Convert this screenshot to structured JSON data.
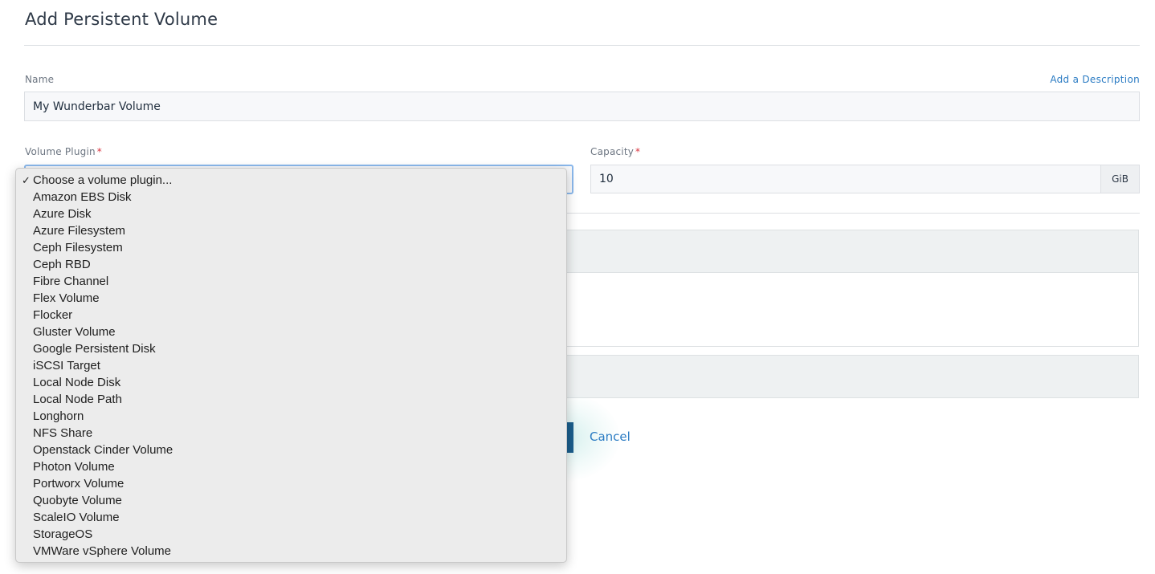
{
  "page": {
    "title": "Add Persistent Volume"
  },
  "name_field": {
    "label": "Name",
    "value": "My Wunderbar Volume",
    "add_description_link": "Add a Description"
  },
  "volume_plugin": {
    "label": "Volume Plugin",
    "required_marker": "*",
    "selected": "Choose a volume plugin...",
    "selected_check": "✓",
    "options": [
      "Choose a volume plugin...",
      "Amazon EBS Disk",
      "Azure Disk",
      "Azure Filesystem",
      "Ceph Filesystem",
      "Ceph RBD",
      "Fibre Channel",
      "Flex Volume",
      "Flocker",
      "Gluster Volume",
      "Google Persistent Disk",
      "iSCSI Target",
      "Local Node Disk",
      "Local Node Path",
      "Longhorn",
      "NFS Share",
      "Openstack Cinder Volume",
      "Photon Volume",
      "Portworx Volume",
      "Quobyte Volume",
      "ScaleIO Volume",
      "StorageOS",
      "VMWare vSphere Volume"
    ]
  },
  "capacity": {
    "label": "Capacity",
    "required_marker": "*",
    "value": "10",
    "unit": "GiB"
  },
  "actions": {
    "cancel_label": "Cancel"
  },
  "colors": {
    "link": "#2a7bc3",
    "required": "#d9343f",
    "primary_button": "#1b5e8c",
    "focus_border": "#8ab8ec"
  }
}
